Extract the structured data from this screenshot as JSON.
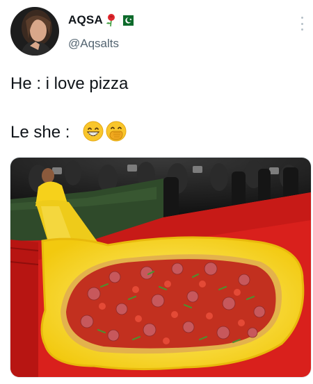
{
  "tweet": {
    "author": {
      "display_name": "AQSA",
      "name_emojis": [
        "rose-emoji",
        "pakistan-flag-emoji"
      ],
      "handle": "@Aqsalts",
      "avatar": "profile-photo"
    },
    "text": "He : i love pizza\n\nLe she :",
    "text_emojis": [
      "grinning-face-emoji",
      "face-with-hand-over-mouth-emoji"
    ],
    "media": {
      "type": "photo",
      "description_icon": "photo-of-yellow-pizza-gown-on-red-carpet"
    },
    "menu_icon": "more-vertical-icon"
  },
  "colors": {
    "text": "#0f1419",
    "secondary_text": "#536471",
    "carpet_red": "#d9201c",
    "gown_yellow": "#f5d11a"
  }
}
